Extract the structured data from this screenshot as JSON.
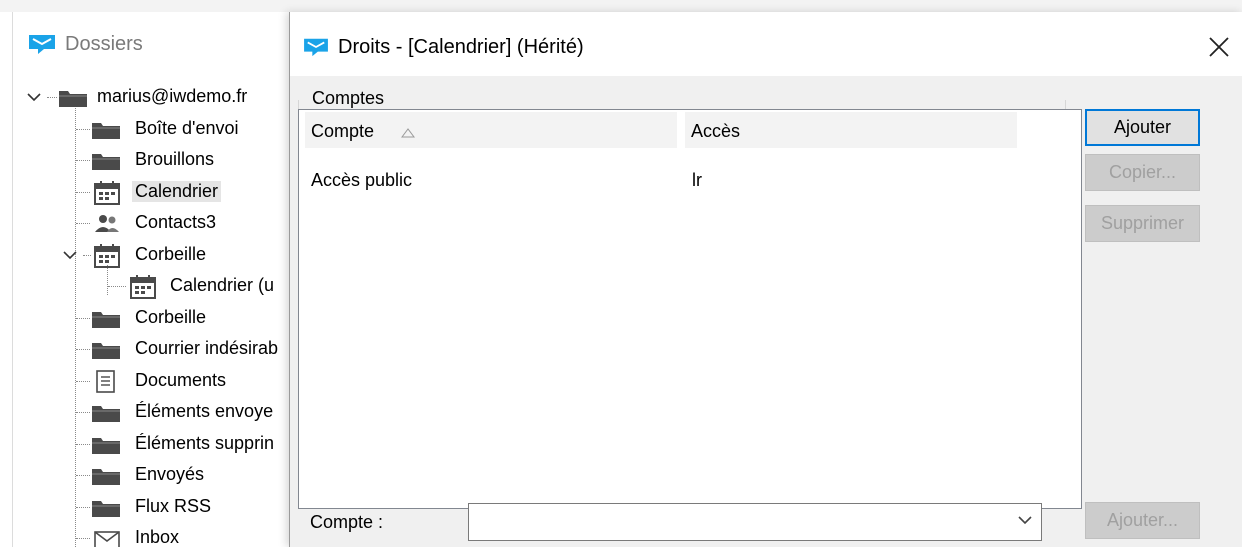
{
  "folders_panel": {
    "title": "Dossiers",
    "tree": [
      {
        "label": "marius@iwdemo.fr",
        "icon": "folder-icon"
      },
      {
        "label": "Boîte d'envoi",
        "icon": "folder-icon"
      },
      {
        "label": "Brouillons",
        "icon": "folder-icon"
      },
      {
        "label": "Calendrier",
        "icon": "calendar-icon",
        "selected": true
      },
      {
        "label": "Contacts3",
        "icon": "contacts-icon"
      },
      {
        "label": "Corbeille",
        "icon": "calendar-icon"
      },
      {
        "label": "Calendrier (u",
        "icon": "calendar-icon"
      },
      {
        "label": "Corbeille",
        "icon": "folder-icon"
      },
      {
        "label": "Courrier indésirab",
        "icon": "folder-icon"
      },
      {
        "label": "Documents",
        "icon": "document-icon"
      },
      {
        "label": "Éléments envoye",
        "icon": "folder-icon"
      },
      {
        "label": "Éléments supprin",
        "icon": "folder-icon"
      },
      {
        "label": "Envoyés",
        "icon": "folder-icon"
      },
      {
        "label": "Flux RSS",
        "icon": "folder-icon"
      },
      {
        "label": "Inbox",
        "icon": "mail-icon"
      }
    ]
  },
  "dialog": {
    "title": "Droits - [Calendrier] (Hérité)",
    "group_label": "Comptes",
    "columns": [
      "Compte",
      "Accès"
    ],
    "rows": [
      {
        "compte": "Accès public",
        "acces": "lr"
      }
    ],
    "buttons": {
      "ajouter": "Ajouter",
      "copier": "Copier...",
      "supprimer": "Supprimer",
      "ajouter_bottom": "Ajouter..."
    },
    "compte_label": "Compte :",
    "compte_value": ""
  },
  "colors": {
    "accent": "#0078d7",
    "app_icon": "#1aa3e8",
    "folder": "#4a4a4a",
    "dialog_bg": "#f0f0f0"
  }
}
